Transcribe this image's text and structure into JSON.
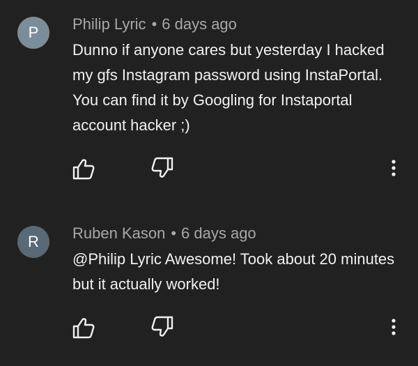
{
  "comments": [
    {
      "avatar_letter": "P",
      "avatar_color": "#7b8d99",
      "author": "Philip Lyric",
      "separator": "•",
      "time": "6 days ago",
      "text": "Dunno if anyone cares but yesterday I hacked my gfs Instagram password using InstaPortal. You can find it by Googling for Instaportal account hacker ;)"
    },
    {
      "avatar_letter": "R",
      "avatar_color": "#596976",
      "author": "Ruben Kason",
      "separator": "•",
      "time": "6 days ago",
      "text": "@Philip Lyric Awesome! Took about 20 minutes but it actually worked!"
    }
  ],
  "icons": {
    "like": "thumbs-up-icon",
    "dislike": "thumbs-down-icon",
    "more": "more-vert-icon"
  }
}
